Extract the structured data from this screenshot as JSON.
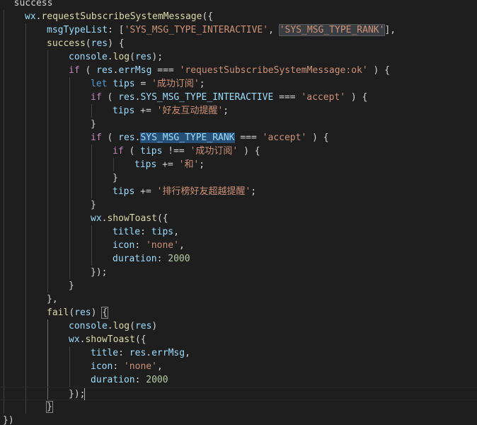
{
  "editor": {
    "language": "javascript",
    "theme_colors": {
      "background": "#1e1e1e",
      "keyword": "#569cd6",
      "control": "#c586c0",
      "variable": "#9cdcfe",
      "function": "#dcdcaa",
      "string": "#ce9178",
      "number": "#b5cea8",
      "punctuation": "#d4d4d4",
      "highlight": "#264f78"
    },
    "lines": [
      {
        "indent": 0,
        "tokens": [
          [
            "t-str",
            "  "
          ],
          [
            "t-pun",
            "success"
          ]
        ]
      },
      {
        "indent": 1,
        "tokens": [
          [
            "t-var",
            "wx"
          ],
          [
            "t-pun",
            "."
          ],
          [
            "t-fn",
            "requestSubscribeSystemMessage"
          ],
          [
            "t-pun",
            "({"
          ]
        ]
      },
      {
        "indent": 2,
        "tokens": [
          [
            "t-var",
            "msgTypeList"
          ],
          [
            "t-pun",
            ": ["
          ],
          [
            "t-str",
            "'SYS_MSG_TYPE_INTERACTIVE'"
          ],
          [
            "t-pun",
            ", "
          ],
          [
            "t-str-sel",
            "'SYS_MSG_TYPE_RANK'"
          ],
          [
            "t-pun",
            "],"
          ]
        ]
      },
      {
        "indent": 2,
        "tokens": [
          [
            "t-fn",
            "success"
          ],
          [
            "t-pun",
            "("
          ],
          [
            "t-var",
            "res"
          ],
          [
            "t-pun",
            ") {"
          ]
        ]
      },
      {
        "indent": 3,
        "tokens": [
          [
            "t-var",
            "console"
          ],
          [
            "t-pun",
            "."
          ],
          [
            "t-fn",
            "log"
          ],
          [
            "t-pun",
            "("
          ],
          [
            "t-var",
            "res"
          ],
          [
            "t-pun",
            ");"
          ]
        ]
      },
      {
        "indent": 3,
        "tokens": [
          [
            "t-ctl",
            "if"
          ],
          [
            "t-pun",
            " ( "
          ],
          [
            "t-var",
            "res"
          ],
          [
            "t-pun",
            "."
          ],
          [
            "t-var",
            "errMsg"
          ],
          [
            "t-pun",
            " === "
          ],
          [
            "t-str",
            "'requestSubscribeSystemMessage:ok'"
          ],
          [
            "t-pun",
            " ) {"
          ]
        ]
      },
      {
        "indent": 4,
        "tokens": [
          [
            "t-kw",
            "let"
          ],
          [
            "t-pun",
            " "
          ],
          [
            "t-var",
            "tips"
          ],
          [
            "t-pun",
            " = "
          ],
          [
            "t-str",
            "'成功订阅'"
          ],
          [
            "t-pun",
            ";"
          ]
        ]
      },
      {
        "indent": 4,
        "tokens": [
          [
            "t-ctl",
            "if"
          ],
          [
            "t-pun",
            " ( "
          ],
          [
            "t-var",
            "res"
          ],
          [
            "t-pun",
            "."
          ],
          [
            "t-var",
            "SYS_MSG_TYPE_INTERACTIVE"
          ],
          [
            "t-pun",
            " === "
          ],
          [
            "t-str",
            "'accept'"
          ],
          [
            "t-pun",
            " ) {"
          ]
        ]
      },
      {
        "indent": 5,
        "tokens": [
          [
            "t-var",
            "tips"
          ],
          [
            "t-pun",
            " += "
          ],
          [
            "t-str",
            "'好友互动提醒'"
          ],
          [
            "t-pun",
            ";"
          ]
        ]
      },
      {
        "indent": 4,
        "tokens": [
          [
            "t-pun",
            "}"
          ]
        ]
      },
      {
        "indent": 4,
        "tokens": [
          [
            "t-ctl",
            "if"
          ],
          [
            "t-pun",
            " ( "
          ],
          [
            "t-var",
            "res"
          ],
          [
            "t-pun",
            "."
          ],
          [
            "t-var-hl",
            "SYS_MSG_TYPE_RANK"
          ],
          [
            "t-pun",
            " === "
          ],
          [
            "t-str",
            "'accept'"
          ],
          [
            "t-pun",
            " ) {"
          ]
        ]
      },
      {
        "indent": 5,
        "tokens": [
          [
            "t-ctl",
            "if"
          ],
          [
            "t-pun",
            " ( "
          ],
          [
            "t-var",
            "tips"
          ],
          [
            "t-pun",
            " !== "
          ],
          [
            "t-str",
            "'成功订阅'"
          ],
          [
            "t-pun",
            " ) {"
          ]
        ]
      },
      {
        "indent": 6,
        "tokens": [
          [
            "t-var",
            "tips"
          ],
          [
            "t-pun",
            " += "
          ],
          [
            "t-str",
            "'和'"
          ],
          [
            "t-pun",
            ";"
          ]
        ]
      },
      {
        "indent": 5,
        "tokens": [
          [
            "t-pun",
            "}"
          ]
        ]
      },
      {
        "indent": 5,
        "tokens": [
          [
            "t-var",
            "tips"
          ],
          [
            "t-pun",
            " += "
          ],
          [
            "t-str",
            "'排行榜好友超越提醒'"
          ],
          [
            "t-pun",
            ";"
          ]
        ]
      },
      {
        "indent": 4,
        "tokens": [
          [
            "t-pun",
            "}"
          ]
        ]
      },
      {
        "indent": 4,
        "tokens": [
          [
            "t-var",
            "wx"
          ],
          [
            "t-pun",
            "."
          ],
          [
            "t-fn",
            "showToast"
          ],
          [
            "t-pun",
            "({"
          ]
        ]
      },
      {
        "indent": 5,
        "tokens": [
          [
            "t-var",
            "title"
          ],
          [
            "t-pun",
            ": "
          ],
          [
            "t-var",
            "tips"
          ],
          [
            "t-pun",
            ","
          ]
        ]
      },
      {
        "indent": 5,
        "tokens": [
          [
            "t-var",
            "icon"
          ],
          [
            "t-pun",
            ": "
          ],
          [
            "t-str",
            "'none'"
          ],
          [
            "t-pun",
            ","
          ]
        ]
      },
      {
        "indent": 5,
        "tokens": [
          [
            "t-var",
            "duration"
          ],
          [
            "t-pun",
            ": "
          ],
          [
            "t-num",
            "2000"
          ]
        ]
      },
      {
        "indent": 4,
        "tokens": [
          [
            "t-pun",
            "});"
          ]
        ]
      },
      {
        "indent": 3,
        "tokens": [
          [
            "t-pun",
            "}"
          ]
        ]
      },
      {
        "indent": 2,
        "tokens": [
          [
            "t-pun",
            "},"
          ]
        ]
      },
      {
        "indent": 2,
        "tokens": [
          [
            "t-fn",
            "fail"
          ],
          [
            "t-pun",
            "("
          ],
          [
            "t-var",
            "res"
          ],
          [
            "t-pun",
            ") "
          ],
          [
            "t-pun-bm",
            "{"
          ]
        ]
      },
      {
        "indent": 3,
        "tokens": [
          [
            "t-var",
            "console"
          ],
          [
            "t-pun",
            "."
          ],
          [
            "t-fn",
            "log"
          ],
          [
            "t-pun",
            "("
          ],
          [
            "t-var",
            "res"
          ],
          [
            "t-pun",
            ")"
          ]
        ]
      },
      {
        "indent": 3,
        "tokens": [
          [
            "t-var",
            "wx"
          ],
          [
            "t-pun",
            "."
          ],
          [
            "t-fn",
            "showToast"
          ],
          [
            "t-pun",
            "({"
          ]
        ]
      },
      {
        "indent": 4,
        "tokens": [
          [
            "t-var",
            "title"
          ],
          [
            "t-pun",
            ": "
          ],
          [
            "t-var",
            "res"
          ],
          [
            "t-pun",
            "."
          ],
          [
            "t-var",
            "errMsg"
          ],
          [
            "t-pun",
            ","
          ]
        ]
      },
      {
        "indent": 4,
        "tokens": [
          [
            "t-var",
            "icon"
          ],
          [
            "t-pun",
            ": "
          ],
          [
            "t-str",
            "'none'"
          ],
          [
            "t-pun",
            ","
          ]
        ]
      },
      {
        "indent": 4,
        "tokens": [
          [
            "t-var",
            "duration"
          ],
          [
            "t-pun",
            ": "
          ],
          [
            "t-num",
            "2000"
          ]
        ]
      },
      {
        "indent": 3,
        "tokens": [
          [
            "t-pun",
            "});"
          ],
          [
            "caret",
            ""
          ]
        ],
        "current": true
      },
      {
        "indent": 2,
        "tokens": [
          [
            "t-pun-bm",
            "}"
          ]
        ]
      },
      {
        "indent": 0,
        "tokens": [
          [
            "t-pun",
            "})"
          ]
        ]
      }
    ]
  }
}
